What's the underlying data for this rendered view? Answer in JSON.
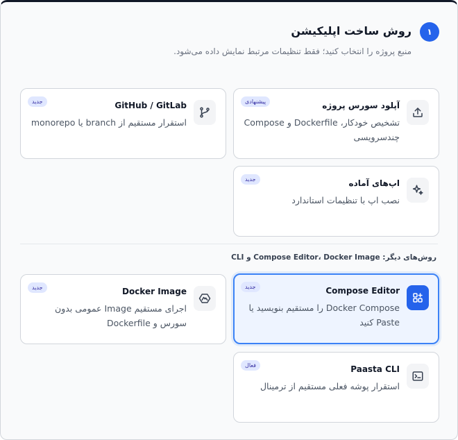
{
  "header": {
    "step_number": "۱",
    "title": "روش ساخت اپلیکیشن",
    "subtitle": "منبع پروژه را انتخاب کنید؛ فقط تنظیمات مرتبط نمایش داده می‌شود."
  },
  "primary_sources": [
    {
      "key": "upload",
      "title": "آپلود سورس پروژه",
      "description": "تشخیص خودکار، Dockerfile و Compose چندسرویسی",
      "badge": "پیشنهادی",
      "icon": "upload-icon"
    },
    {
      "key": "github",
      "title": "GitHub / GitLab",
      "description": "استقرار مستقیم از branch یا monorepo",
      "badge": "جدید",
      "icon": "git-branch-icon"
    },
    {
      "key": "marketplace",
      "title": "اپ‌های آماده",
      "description": "نصب اپ با تنظیمات استاندارد",
      "badge": "جدید",
      "icon": "sparkles-icon"
    }
  ],
  "other_methods": {
    "label": "روش‌های دیگر: Compose Editor، Docker Image و CLI",
    "items": [
      {
        "key": "compose",
        "title": "Compose Editor",
        "description": "Docker Compose را مستقیم بنویسید یا Paste کنید",
        "badge": "جدید",
        "icon": "compose-blocks-icon",
        "selected": true
      },
      {
        "key": "docker",
        "title": "Docker Image",
        "description": "اجرای مستقیم Image عمومی بدون سورس و Dockerfile",
        "badge": "جدید",
        "icon": "docker-image-icon",
        "selected": false
      },
      {
        "key": "cli",
        "title": "Paasta CLI",
        "description": "استقرار پوشه فعلی مستقیم از ترمینال",
        "badge": "فعال",
        "icon": "terminal-icon",
        "selected": false
      }
    ]
  },
  "colors": {
    "accent": "#2563eb",
    "badge_bg": "#e0e7ff",
    "badge_text": "#3730a3",
    "selected_bg": "#eef4ff"
  }
}
